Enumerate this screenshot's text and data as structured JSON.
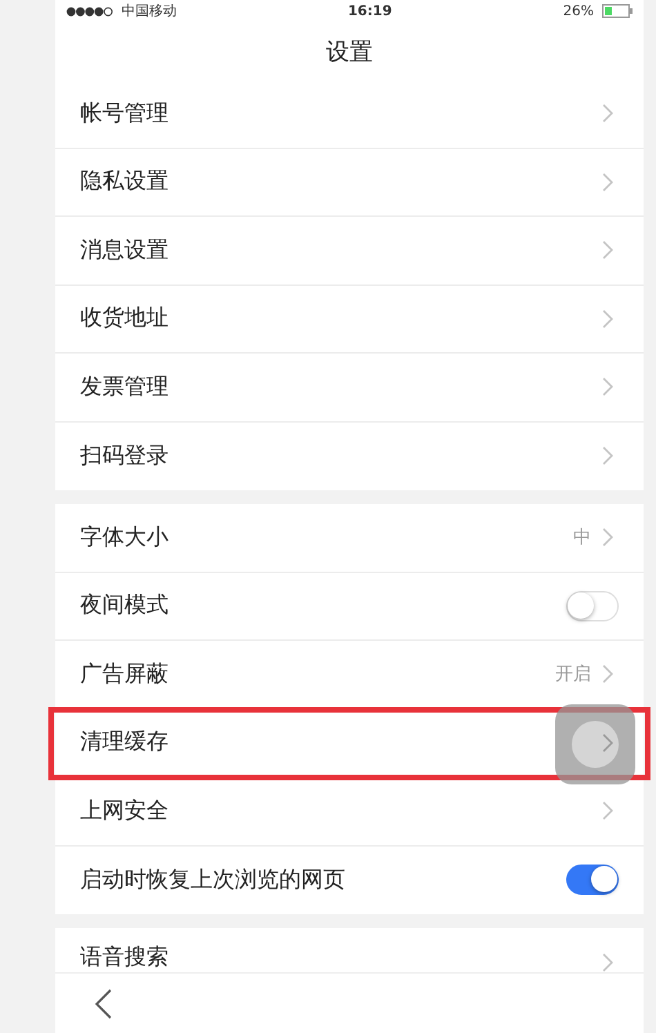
{
  "status_bar": {
    "carrier": "中国移动",
    "time": "16:19",
    "battery": "26%"
  },
  "header": {
    "title": "设置"
  },
  "groups": [
    {
      "rows": [
        {
          "label": "帐号管理",
          "kind": "chevron"
        },
        {
          "label": "隐私设置",
          "kind": "chevron"
        },
        {
          "label": "消息设置",
          "kind": "chevron"
        },
        {
          "label": "收货地址",
          "kind": "chevron"
        },
        {
          "label": "发票管理",
          "kind": "chevron"
        },
        {
          "label": "扫码登录",
          "kind": "chevron"
        }
      ]
    },
    {
      "rows": [
        {
          "label": "字体大小",
          "kind": "value",
          "value": "中"
        },
        {
          "label": "夜间模式",
          "kind": "toggle",
          "on": false
        },
        {
          "label": "广告屏蔽",
          "kind": "value",
          "value": "开启"
        },
        {
          "label": "清理缓存",
          "kind": "chevron",
          "highlighted": true
        },
        {
          "label": "上网安全",
          "kind": "chevron"
        },
        {
          "label": "启动时恢复上次浏览的网页",
          "kind": "toggle",
          "on": true
        }
      ]
    },
    {
      "rows": [
        {
          "label": "语音搜索",
          "kind": "chevron"
        }
      ]
    }
  ]
}
